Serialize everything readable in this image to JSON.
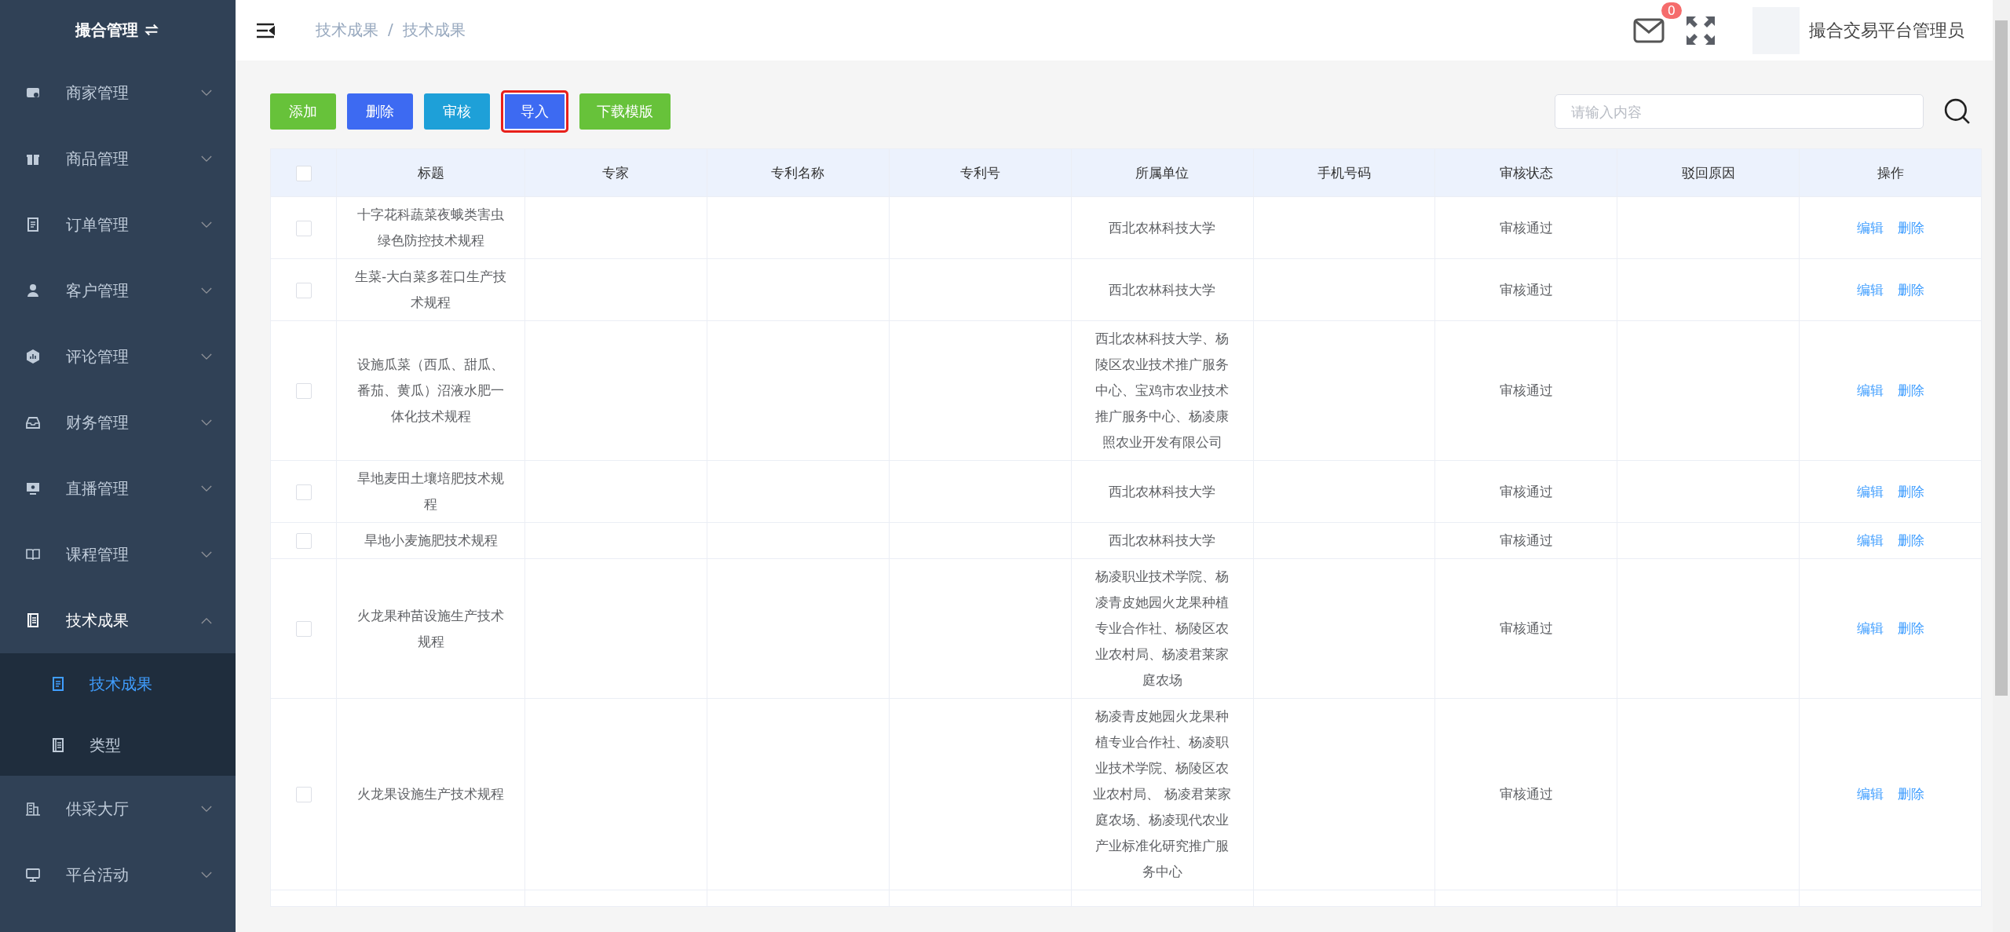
{
  "sidebar": {
    "title": "撮合管理",
    "items": [
      {
        "label": "商家管理",
        "kind": "shop",
        "expanded": false
      },
      {
        "label": "商品管理",
        "kind": "gift",
        "expanded": false
      },
      {
        "label": "订单管理",
        "kind": "doc",
        "expanded": false
      },
      {
        "label": "客户管理",
        "kind": "user",
        "expanded": false
      },
      {
        "label": "评论管理",
        "kind": "hex",
        "expanded": false
      },
      {
        "label": "财务管理",
        "kind": "inbox",
        "expanded": false
      },
      {
        "label": "直播管理",
        "kind": "screen",
        "expanded": false
      },
      {
        "label": "课程管理",
        "kind": "book",
        "expanded": false
      },
      {
        "label": "技术成果",
        "kind": "list",
        "expanded": true,
        "children": [
          {
            "label": "技术成果",
            "kind": "doc",
            "selected": true
          },
          {
            "label": "类型",
            "kind": "list",
            "selected": false
          }
        ]
      },
      {
        "label": "供采大厅",
        "kind": "building",
        "expanded": false
      },
      {
        "label": "平台活动",
        "kind": "monitor",
        "expanded": false
      }
    ]
  },
  "header": {
    "breadcrumb": [
      "技术成果",
      "技术成果"
    ],
    "breadcrumb_separator": "/",
    "mail_count": "0",
    "user": "撮合交易平台管理员"
  },
  "toolbar": {
    "buttons": [
      {
        "label": "添加",
        "kind": "green",
        "highlighted": false
      },
      {
        "label": "删除",
        "kind": "blue",
        "highlighted": false
      },
      {
        "label": "审核",
        "kind": "cyan",
        "highlighted": false
      },
      {
        "label": "导入",
        "kind": "blue",
        "highlighted": true
      },
      {
        "label": "下载模版",
        "kind": "green",
        "highlighted": false
      }
    ],
    "search": {
      "placeholder": "请输入内容"
    }
  },
  "table": {
    "columns": [
      "标题",
      "专家",
      "专利名称",
      "专利号",
      "所属单位",
      "手机号码",
      "审核状态",
      "驳回原因",
      "操作"
    ],
    "header_checked": false,
    "rows": [
      {
        "checked": false,
        "cells": [
          "十字花科蔬菜夜蛾类害虫绿色防控技术规程",
          "",
          "",
          "",
          "西北农林科技大学",
          "",
          "审核通过",
          ""
        ],
        "actions": [
          "编辑",
          "删除"
        ]
      },
      {
        "checked": false,
        "cells": [
          "生菜-大白菜多茬口生产技术规程",
          "",
          "",
          "",
          "西北农林科技大学",
          "",
          "审核通过",
          ""
        ],
        "actions": [
          "编辑",
          "删除"
        ]
      },
      {
        "checked": false,
        "cells": [
          "设施瓜菜（西瓜、甜瓜、番茄、黄瓜）沼液水肥一体化技术规程",
          "",
          "",
          "",
          "西北农林科技大学、杨陵区农业技术推广服务中心、宝鸡市农业技术推广服务中心、杨凌康照农业开发有限公司",
          "",
          "审核通过",
          ""
        ],
        "actions": [
          "编辑",
          "删除"
        ]
      },
      {
        "checked": false,
        "cells": [
          "旱地麦田土壤培肥技术规程",
          "",
          "",
          "",
          "西北农林科技大学",
          "",
          "审核通过",
          ""
        ],
        "actions": [
          "编辑",
          "删除"
        ]
      },
      {
        "checked": false,
        "cells": [
          "旱地小麦施肥技术规程",
          "",
          "",
          "",
          "西北农林科技大学",
          "",
          "审核通过",
          ""
        ],
        "actions": [
          "编辑",
          "删除"
        ]
      },
      {
        "checked": false,
        "cells": [
          "火龙果种苗设施生产技术规程",
          "",
          "",
          "",
          "杨凌职业技术学院、杨凌青皮她园火龙果种植专业合作社、杨陵区农业农村局、杨凌君莱家庭农场",
          "",
          "审核通过",
          ""
        ],
        "actions": [
          "编辑",
          "删除"
        ]
      },
      {
        "checked": false,
        "cells": [
          "火龙果设施生产技术规程",
          "",
          "",
          "",
          "杨凌青皮她园火龙果种植专业合作社、杨凌职业技术学院、杨陵区农业农村局、 杨凌君莱家庭农场、杨凌现代农业产业标准化研究推广服务中心",
          "",
          "审核通过",
          ""
        ],
        "actions": [
          "编辑",
          "删除"
        ]
      }
    ]
  }
}
